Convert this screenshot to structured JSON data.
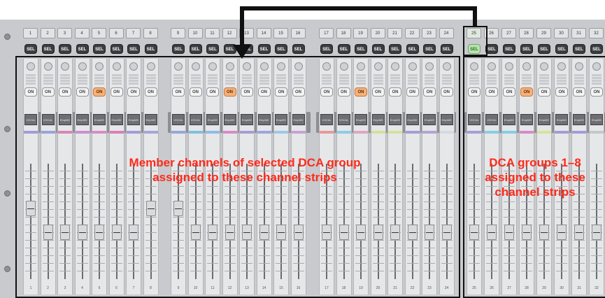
{
  "strips_left": [
    {
      "num": "1",
      "sel": "SEL",
      "on": "ON",
      "on_color": "gray",
      "name": "VOCAL",
      "color": "#a39bd8",
      "fader": 0.62
    },
    {
      "num": "2",
      "sel": "SEL",
      "on": "ON",
      "on_color": "gray",
      "name": "VOCAL",
      "color": "#9aa3db",
      "fader": 0.38
    },
    {
      "num": "3",
      "sel": "SEL",
      "on": "ON",
      "on_color": "gray",
      "name": "EmpMX",
      "color": "#d986b4",
      "fader": 0.38
    },
    {
      "num": "4",
      "sel": "SEL",
      "on": "ON",
      "on_color": "gray",
      "name": "EmpMX",
      "color": "#cc8ed2",
      "fader": 0.38
    },
    {
      "num": "5",
      "sel": "SEL",
      "on": "ON",
      "on_color": "orange",
      "name": "EmpMX",
      "color": "#d98bc7",
      "fader": 0.38
    },
    {
      "num": "6",
      "sel": "SEL",
      "on": "ON",
      "on_color": "gray",
      "name": "EmpMX",
      "color": "#db7fb4",
      "fader": 0.38
    },
    {
      "num": "7",
      "sel": "SEL",
      "on": "ON",
      "on_color": "gray",
      "name": "EmpMX",
      "color": "#a49bd8",
      "fader": 0.38
    },
    {
      "num": "8",
      "sel": "SEL",
      "on": "ON",
      "on_color": "gray",
      "name": "EmpMX",
      "color": "#a7a6d9",
      "fader": 0.62
    },
    {
      "num": "9",
      "sel": "SEL",
      "on": "ON",
      "on_color": "gray",
      "name": "VOCAL",
      "color": "#96a7da",
      "fader": 0.62
    },
    {
      "num": "10",
      "sel": "SEL",
      "on": "ON",
      "on_color": "gray",
      "name": "VOCAL",
      "color": "#7fc1de",
      "fader": 0.38
    },
    {
      "num": "11",
      "sel": "SEL",
      "on": "ON",
      "on_color": "gray",
      "name": "EmpMX",
      "color": "#8fbde6",
      "fader": 0.38
    },
    {
      "num": "12",
      "sel": "SEL",
      "on": "ON",
      "on_color": "orange",
      "name": "EmpMX",
      "color": "#d98bc7",
      "fader": 0.38
    },
    {
      "num": "13",
      "sel": "SEL",
      "on": "ON",
      "on_color": "gray",
      "name": "EmpMX",
      "color": "#a89bd6",
      "fader": 0.38
    },
    {
      "num": "14",
      "sel": "SEL",
      "on": "ON",
      "on_color": "gray",
      "name": "EmpMX",
      "color": "#9da7dd",
      "fader": 0.38
    },
    {
      "num": "15",
      "sel": "SEL",
      "on": "ON",
      "on_color": "gray",
      "name": "EmpMX",
      "color": "#9fc8e6",
      "fader": 0.38
    },
    {
      "num": "16",
      "sel": "SEL",
      "on": "ON",
      "on_color": "gray",
      "name": "EmpMX",
      "color": "#c6a2d8",
      "fader": 0.38
    },
    {
      "num": "17",
      "sel": "SEL",
      "on": "ON",
      "on_color": "gray",
      "name": "VOCAL",
      "color": "#e69a9e",
      "fader": 0.38
    },
    {
      "num": "18",
      "sel": "SEL",
      "on": "ON",
      "on_color": "gray",
      "name": "VOCAL",
      "color": "#8dcce6",
      "fader": 0.38
    },
    {
      "num": "19",
      "sel": "SEL",
      "on": "ON",
      "on_color": "orange",
      "name": "EmpMX",
      "color": "#e0a6c2",
      "fader": 0.38
    },
    {
      "num": "20",
      "sel": "SEL",
      "on": "ON",
      "on_color": "gray",
      "name": "EmpMX",
      "color": "#cfe399",
      "fader": 0.38
    },
    {
      "num": "21",
      "sel": "SEL",
      "on": "ON",
      "on_color": "gray",
      "name": "EmpMX",
      "color": "#d1e39b",
      "fader": 0.38
    },
    {
      "num": "22",
      "sel": "SEL",
      "on": "ON",
      "on_color": "gray",
      "name": "EmpMX",
      "color": "#a69cd7",
      "fader": 0.38
    },
    {
      "num": "23",
      "sel": "SEL",
      "on": "ON",
      "on_color": "gray",
      "name": "EmpMX",
      "color": "#b3a3d6",
      "fader": 0.38
    },
    {
      "num": "24",
      "sel": "SEL",
      "on": "ON",
      "on_color": "gray",
      "name": "EmpMX",
      "color": "#d6d9e0",
      "fader": 0.38
    }
  ],
  "strips_right": [
    {
      "num": "25",
      "sel": "SEL",
      "on": "ON",
      "on_color": "gray",
      "name": "VOCAL",
      "color": "#a3a0d8",
      "fader": 0.38,
      "selected": true
    },
    {
      "num": "26",
      "sel": "SEL",
      "on": "ON",
      "on_color": "gray",
      "name": "VOCAL",
      "color": "#86cde6",
      "fader": 0.38
    },
    {
      "num": "27",
      "sel": "SEL",
      "on": "ON",
      "on_color": "gray",
      "name": "EmpMX",
      "color": "#86cde6",
      "fader": 0.38
    },
    {
      "num": "28",
      "sel": "SEL",
      "on": "ON",
      "on_color": "orange",
      "name": "EmpMX",
      "color": "#d98bc7",
      "fader": 0.38
    },
    {
      "num": "29",
      "sel": "SEL",
      "on": "ON",
      "on_color": "gray",
      "name": "EmpMX",
      "color": "#d7e39b",
      "fader": 0.38
    },
    {
      "num": "30",
      "sel": "SEL",
      "on": "ON",
      "on_color": "gray",
      "name": "EmpMX",
      "color": "#a49bd8",
      "fader": 0.38
    },
    {
      "num": "31",
      "sel": "SEL",
      "on": "ON",
      "on_color": "gray",
      "name": "EmpMX",
      "color": "#a49bd8",
      "fader": 0.38
    },
    {
      "num": "32",
      "sel": "SEL",
      "on": "ON",
      "on_color": "gray",
      "name": "EmpMX",
      "color": "#c6c6cc",
      "fader": 0.38
    }
  ],
  "labels": {
    "left": "Member channels of selected DCA group\nassigned to these channel strips",
    "right": "DCA groups 1–8\nassigned to these\nchannel strips"
  },
  "colors": {
    "annotation": "#ff2a1a",
    "frame": "#111111",
    "sel_active": "#b7e3b0",
    "on_orange": "#f6b27a"
  },
  "icons": {
    "knob": "rotary-knob-icon",
    "arrow": "down-arrow-icon"
  }
}
